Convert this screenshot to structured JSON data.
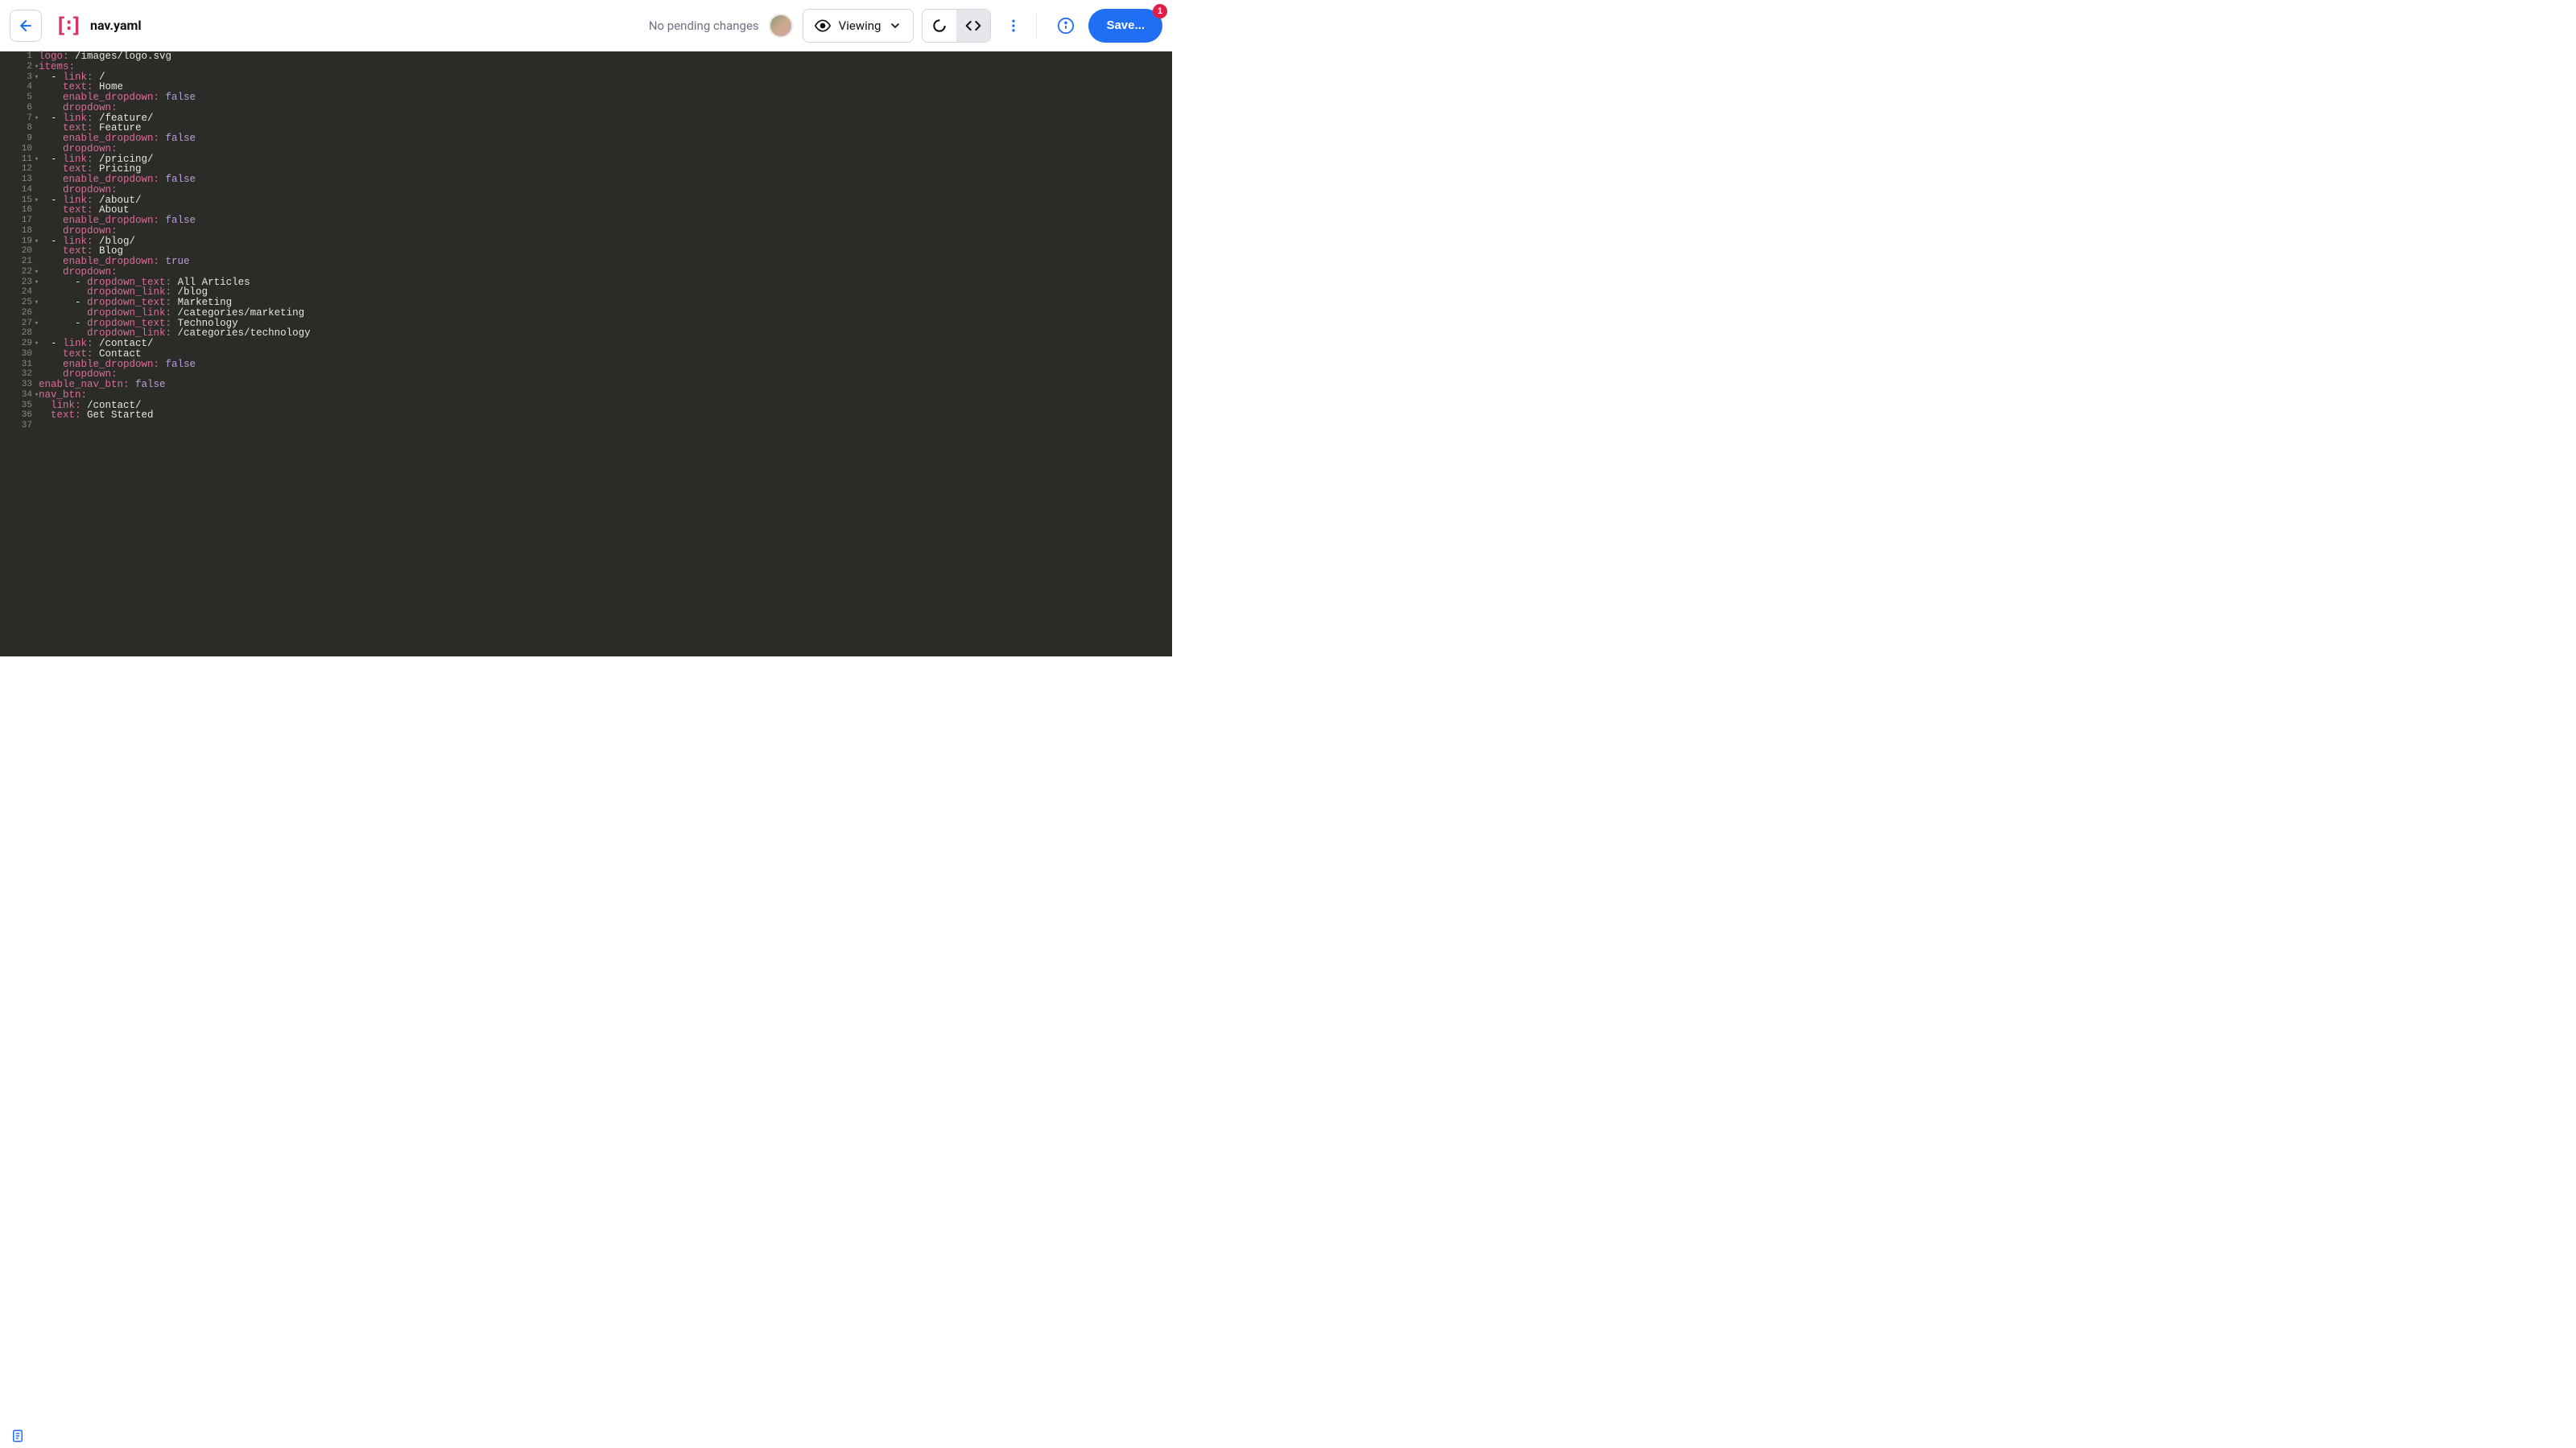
{
  "header": {
    "file_title": "nav.yaml",
    "status": "No pending changes",
    "view_mode_label": "Viewing",
    "save_label": "Save...",
    "badge_count": "1"
  },
  "code": {
    "lines": [
      {
        "n": 1,
        "fold": false,
        "tokens": [
          {
            "t": "key",
            "s": "logo:"
          },
          {
            "t": "val",
            "s": " /images/logo.svg"
          }
        ]
      },
      {
        "n": 2,
        "fold": true,
        "tokens": [
          {
            "t": "key",
            "s": "items:"
          }
        ]
      },
      {
        "n": 3,
        "fold": true,
        "tokens": [
          {
            "t": "pad",
            "s": "  "
          },
          {
            "t": "dash",
            "s": "- "
          },
          {
            "t": "key",
            "s": "link:"
          },
          {
            "t": "val",
            "s": " /"
          }
        ]
      },
      {
        "n": 4,
        "fold": false,
        "tokens": [
          {
            "t": "pad",
            "s": "    "
          },
          {
            "t": "key",
            "s": "text:"
          },
          {
            "t": "val",
            "s": " Home"
          }
        ]
      },
      {
        "n": 5,
        "fold": false,
        "tokens": [
          {
            "t": "pad",
            "s": "    "
          },
          {
            "t": "key",
            "s": "enable_dropdown:"
          },
          {
            "t": "bool",
            "s": " false"
          }
        ]
      },
      {
        "n": 6,
        "fold": false,
        "tokens": [
          {
            "t": "pad",
            "s": "    "
          },
          {
            "t": "key",
            "s": "dropdown:"
          }
        ]
      },
      {
        "n": 7,
        "fold": true,
        "tokens": [
          {
            "t": "pad",
            "s": "  "
          },
          {
            "t": "dash",
            "s": "- "
          },
          {
            "t": "key",
            "s": "link:"
          },
          {
            "t": "val",
            "s": " /feature/"
          }
        ]
      },
      {
        "n": 8,
        "fold": false,
        "tokens": [
          {
            "t": "pad",
            "s": "    "
          },
          {
            "t": "key",
            "s": "text:"
          },
          {
            "t": "val",
            "s": " Feature"
          }
        ]
      },
      {
        "n": 9,
        "fold": false,
        "tokens": [
          {
            "t": "pad",
            "s": "    "
          },
          {
            "t": "key",
            "s": "enable_dropdown:"
          },
          {
            "t": "bool",
            "s": " false"
          }
        ]
      },
      {
        "n": 10,
        "fold": false,
        "tokens": [
          {
            "t": "pad",
            "s": "    "
          },
          {
            "t": "key",
            "s": "dropdown:"
          }
        ]
      },
      {
        "n": 11,
        "fold": true,
        "tokens": [
          {
            "t": "pad",
            "s": "  "
          },
          {
            "t": "dash",
            "s": "- "
          },
          {
            "t": "key",
            "s": "link:"
          },
          {
            "t": "val",
            "s": " /pricing/"
          }
        ]
      },
      {
        "n": 12,
        "fold": false,
        "tokens": [
          {
            "t": "pad",
            "s": "    "
          },
          {
            "t": "key",
            "s": "text:"
          },
          {
            "t": "val",
            "s": " Pricing"
          }
        ]
      },
      {
        "n": 13,
        "fold": false,
        "tokens": [
          {
            "t": "pad",
            "s": "    "
          },
          {
            "t": "key",
            "s": "enable_dropdown:"
          },
          {
            "t": "bool",
            "s": " false"
          }
        ]
      },
      {
        "n": 14,
        "fold": false,
        "tokens": [
          {
            "t": "pad",
            "s": "    "
          },
          {
            "t": "key",
            "s": "dropdown:"
          }
        ]
      },
      {
        "n": 15,
        "fold": true,
        "tokens": [
          {
            "t": "pad",
            "s": "  "
          },
          {
            "t": "dash",
            "s": "- "
          },
          {
            "t": "key",
            "s": "link:"
          },
          {
            "t": "val",
            "s": " /about/"
          }
        ]
      },
      {
        "n": 16,
        "fold": false,
        "tokens": [
          {
            "t": "pad",
            "s": "    "
          },
          {
            "t": "key",
            "s": "text:"
          },
          {
            "t": "val",
            "s": " About"
          }
        ]
      },
      {
        "n": 17,
        "fold": false,
        "tokens": [
          {
            "t": "pad",
            "s": "    "
          },
          {
            "t": "key",
            "s": "enable_dropdown:"
          },
          {
            "t": "bool",
            "s": " false"
          }
        ]
      },
      {
        "n": 18,
        "fold": false,
        "tokens": [
          {
            "t": "pad",
            "s": "    "
          },
          {
            "t": "key",
            "s": "dropdown:"
          }
        ]
      },
      {
        "n": 19,
        "fold": true,
        "tokens": [
          {
            "t": "pad",
            "s": "  "
          },
          {
            "t": "dash",
            "s": "- "
          },
          {
            "t": "key",
            "s": "link:"
          },
          {
            "t": "val",
            "s": " /blog/"
          }
        ]
      },
      {
        "n": 20,
        "fold": false,
        "tokens": [
          {
            "t": "pad",
            "s": "    "
          },
          {
            "t": "key",
            "s": "text:"
          },
          {
            "t": "val",
            "s": " Blog"
          }
        ]
      },
      {
        "n": 21,
        "fold": false,
        "tokens": [
          {
            "t": "pad",
            "s": "    "
          },
          {
            "t": "key",
            "s": "enable_dropdown:"
          },
          {
            "t": "bool",
            "s": " true"
          }
        ]
      },
      {
        "n": 22,
        "fold": true,
        "tokens": [
          {
            "t": "pad",
            "s": "    "
          },
          {
            "t": "key",
            "s": "dropdown:"
          }
        ]
      },
      {
        "n": 23,
        "fold": true,
        "tokens": [
          {
            "t": "pad",
            "s": "      "
          },
          {
            "t": "dash",
            "s": "- "
          },
          {
            "t": "key",
            "s": "dropdown_text:"
          },
          {
            "t": "val",
            "s": " All Articles"
          }
        ]
      },
      {
        "n": 24,
        "fold": false,
        "tokens": [
          {
            "t": "pad",
            "s": "        "
          },
          {
            "t": "key",
            "s": "dropdown_link:"
          },
          {
            "t": "val",
            "s": " /blog"
          }
        ]
      },
      {
        "n": 25,
        "fold": true,
        "tokens": [
          {
            "t": "pad",
            "s": "      "
          },
          {
            "t": "dash",
            "s": "- "
          },
          {
            "t": "key",
            "s": "dropdown_text:"
          },
          {
            "t": "val",
            "s": " Marketing"
          }
        ]
      },
      {
        "n": 26,
        "fold": false,
        "tokens": [
          {
            "t": "pad",
            "s": "        "
          },
          {
            "t": "key",
            "s": "dropdown_link:"
          },
          {
            "t": "val",
            "s": " /categories/marketing"
          }
        ]
      },
      {
        "n": 27,
        "fold": true,
        "tokens": [
          {
            "t": "pad",
            "s": "      "
          },
          {
            "t": "dash",
            "s": "- "
          },
          {
            "t": "key",
            "s": "dropdown_text:"
          },
          {
            "t": "val",
            "s": " Technology"
          }
        ]
      },
      {
        "n": 28,
        "fold": false,
        "tokens": [
          {
            "t": "pad",
            "s": "        "
          },
          {
            "t": "key",
            "s": "dropdown_link:"
          },
          {
            "t": "val",
            "s": " /categories/technology"
          }
        ]
      },
      {
        "n": 29,
        "fold": true,
        "tokens": [
          {
            "t": "pad",
            "s": "  "
          },
          {
            "t": "dash",
            "s": "- "
          },
          {
            "t": "key",
            "s": "link:"
          },
          {
            "t": "val",
            "s": " /contact/"
          }
        ]
      },
      {
        "n": 30,
        "fold": false,
        "tokens": [
          {
            "t": "pad",
            "s": "    "
          },
          {
            "t": "key",
            "s": "text:"
          },
          {
            "t": "val",
            "s": " Contact"
          }
        ]
      },
      {
        "n": 31,
        "fold": false,
        "tokens": [
          {
            "t": "pad",
            "s": "    "
          },
          {
            "t": "key",
            "s": "enable_dropdown:"
          },
          {
            "t": "bool",
            "s": " false"
          }
        ]
      },
      {
        "n": 32,
        "fold": false,
        "tokens": [
          {
            "t": "pad",
            "s": "    "
          },
          {
            "t": "key",
            "s": "dropdown:"
          }
        ]
      },
      {
        "n": 33,
        "fold": false,
        "tokens": [
          {
            "t": "key",
            "s": "enable_nav_btn:"
          },
          {
            "t": "bool",
            "s": " false"
          }
        ]
      },
      {
        "n": 34,
        "fold": true,
        "tokens": [
          {
            "t": "key",
            "s": "nav_btn:"
          }
        ]
      },
      {
        "n": 35,
        "fold": false,
        "tokens": [
          {
            "t": "pad",
            "s": "  "
          },
          {
            "t": "key",
            "s": "link:"
          },
          {
            "t": "val",
            "s": " /contact/"
          }
        ]
      },
      {
        "n": 36,
        "fold": false,
        "tokens": [
          {
            "t": "pad",
            "s": "  "
          },
          {
            "t": "key",
            "s": "text:"
          },
          {
            "t": "val",
            "s": " Get Started"
          }
        ]
      },
      {
        "n": 37,
        "fold": false,
        "tokens": []
      }
    ]
  }
}
